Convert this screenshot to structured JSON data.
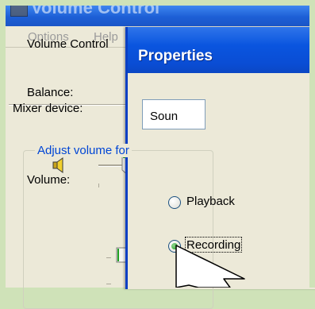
{
  "background_window": {
    "title": "Volume Control",
    "menu": [
      "Options",
      "Help"
    ],
    "panel_title": "Volume Control",
    "balance_label": "Balance:",
    "volume_label": "Volume:",
    "icons": {
      "app": "volume-control-app-icon",
      "speaker": "speaker-icon"
    }
  },
  "dialog": {
    "title": "Properties",
    "mixer_label": "Mixer device:",
    "mixer_value": "Soun",
    "group_legend": "Adjust volume for",
    "options": [
      {
        "label": "Playback",
        "selected": false
      },
      {
        "label": "Recording",
        "selected": true
      }
    ]
  },
  "colors": {
    "frame": "#cfe2b8",
    "titlebar": "#0a55df",
    "group_legend": "#0046d5",
    "radio_selected": "#21a121"
  },
  "cursor": "arrow-cursor-icon"
}
